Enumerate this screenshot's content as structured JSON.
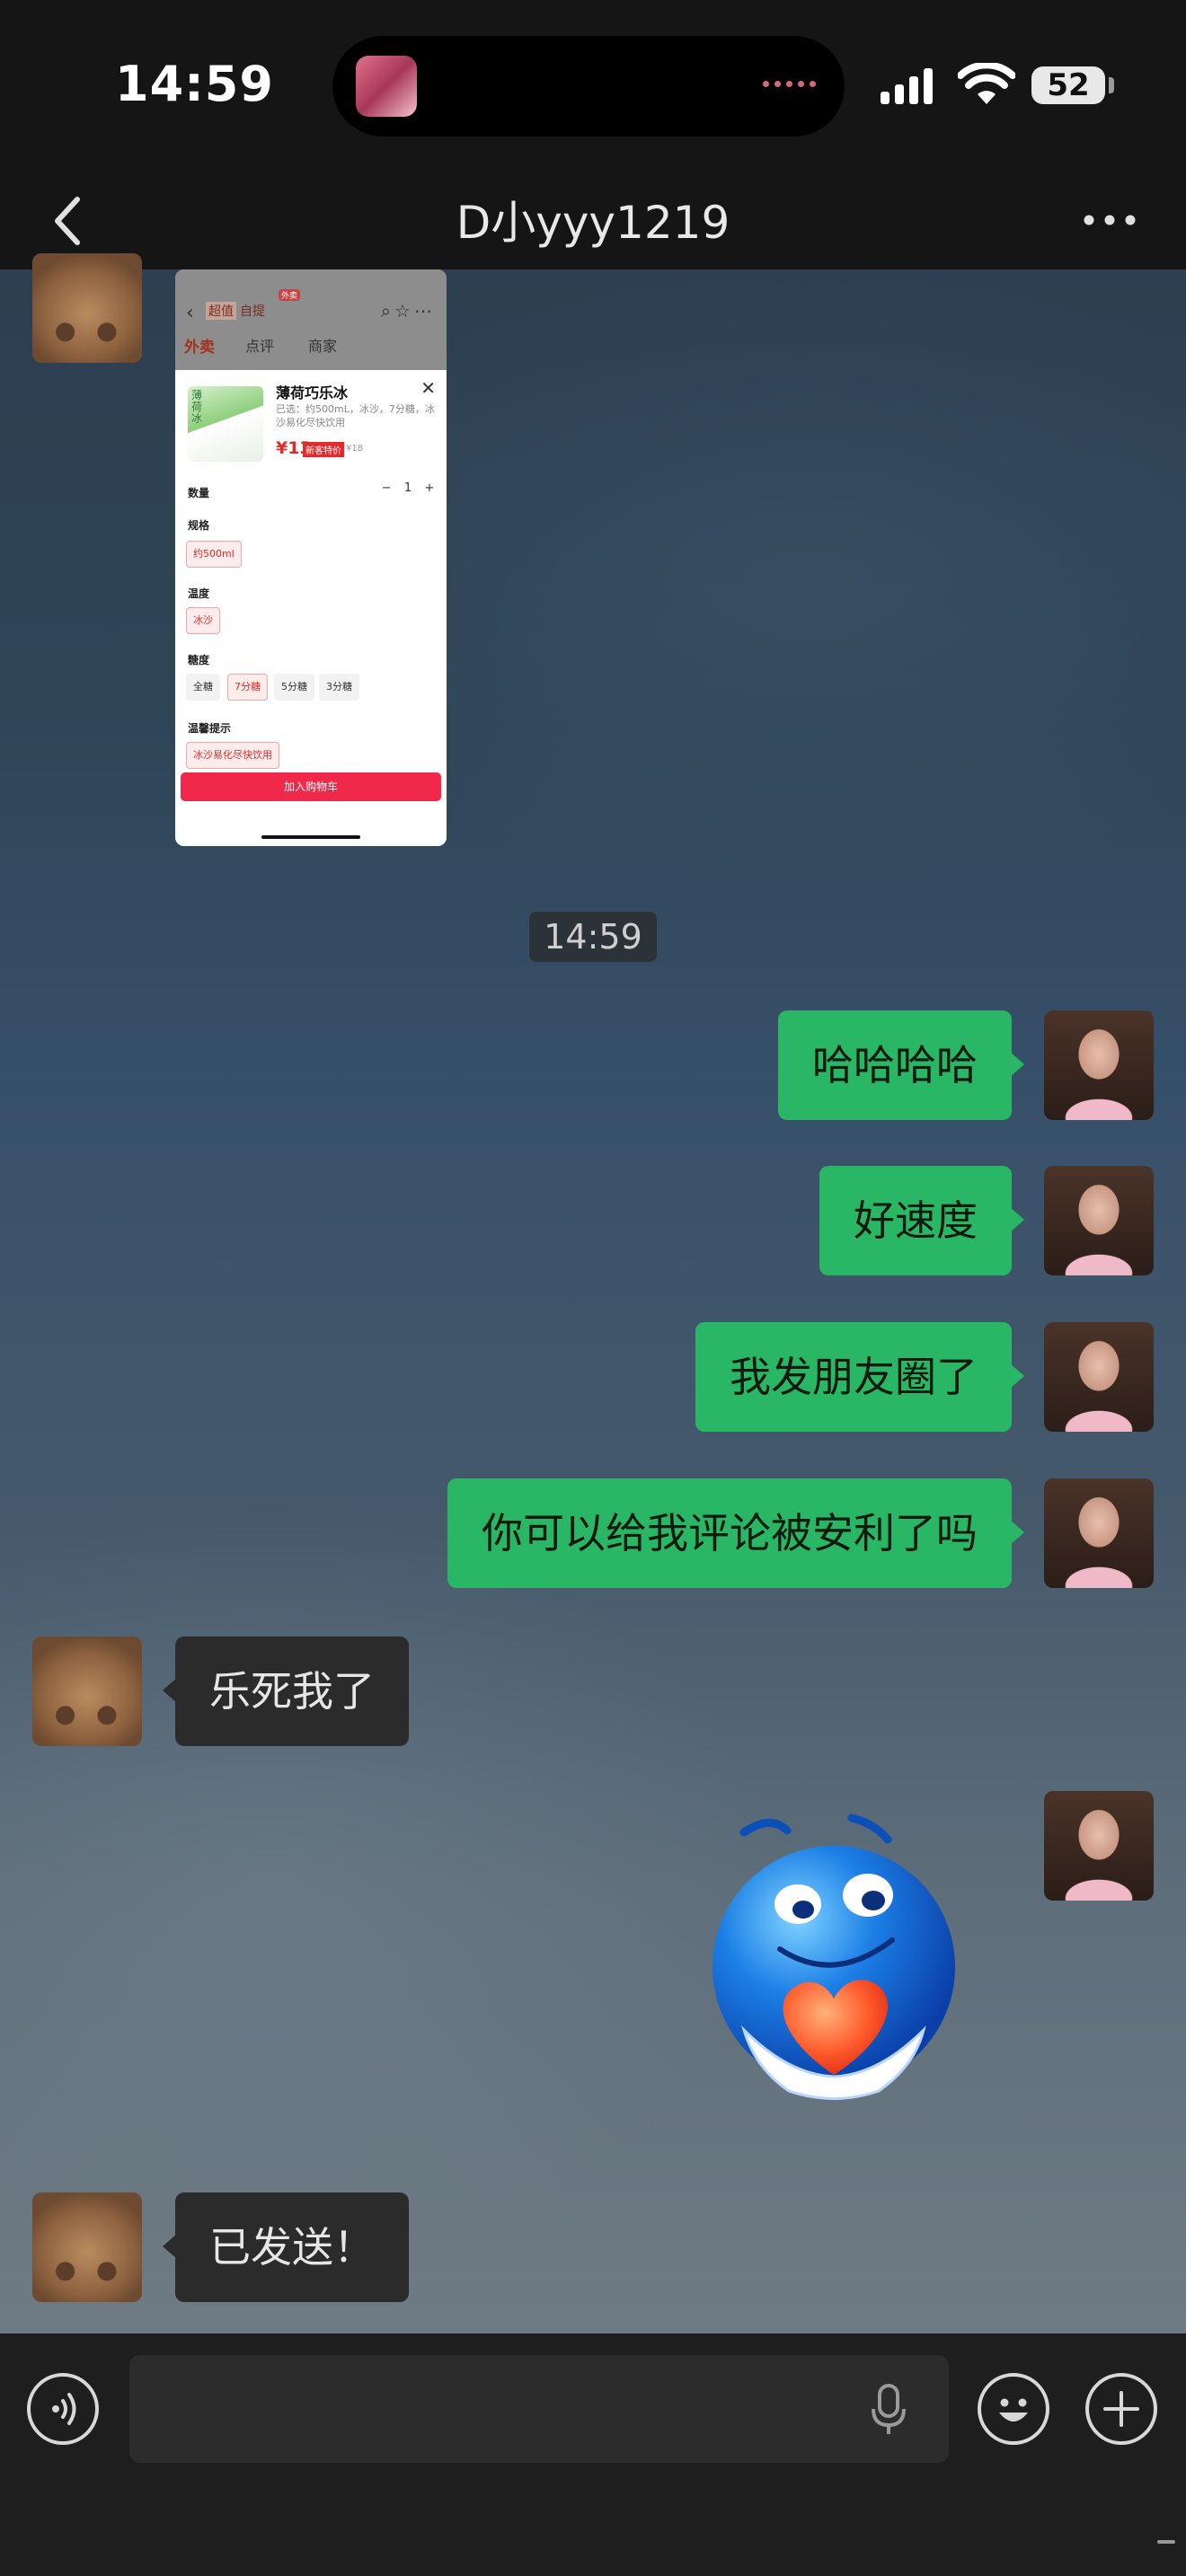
{
  "status_bar": {
    "time": "14:59",
    "battery": "52"
  },
  "nav": {
    "title": "D小yyy1219"
  },
  "shared_screenshot": {
    "header": {
      "tag1": "超值",
      "tag2": "自提",
      "tag3": "外卖",
      "tab1": "外卖",
      "tab2": "点评",
      "tab3": "商家"
    },
    "product_name": "薄荷巧乐冰",
    "thumb_label": "薄荷冰",
    "description": "已选：约500mL，冰沙，7分糖，冰沙易化尽快饮用",
    "price": "¥13",
    "price_badge": "新客特价",
    "old_price": "¥18",
    "quantity_label": "数量",
    "quantity": {
      "minus": "−",
      "value": "1",
      "plus": "+"
    },
    "spec_label": "规格",
    "spec_option": "约500ml",
    "temp_label": "温度",
    "temp_option": "冰沙",
    "sugar_label": "糖度",
    "sugar_options": [
      "全糖",
      "7分糖",
      "5分糖",
      "3分糖"
    ],
    "tip_label": "温馨提示",
    "tip_option": "冰沙易化尽快饮用",
    "cart_button": "加入购物车"
  },
  "timestamp": "14:59",
  "messages": [
    {
      "from": "self",
      "text": "哈哈哈哈"
    },
    {
      "from": "self",
      "text": "好速度"
    },
    {
      "from": "self",
      "text": "我发朋友圈了"
    },
    {
      "from": "self",
      "text": "你可以给我评论被安利了吗"
    },
    {
      "from": "peer",
      "text": "乐死我了"
    },
    {
      "from": "self",
      "sticker": "blue-smiley-holding-heart"
    },
    {
      "from": "peer",
      "text": "已发送！"
    }
  ],
  "input": {
    "placeholder": ""
  },
  "colors": {
    "self_bubble": "#29b765",
    "peer_bubble": "#2b2b2b",
    "bar_background": "#151515"
  }
}
